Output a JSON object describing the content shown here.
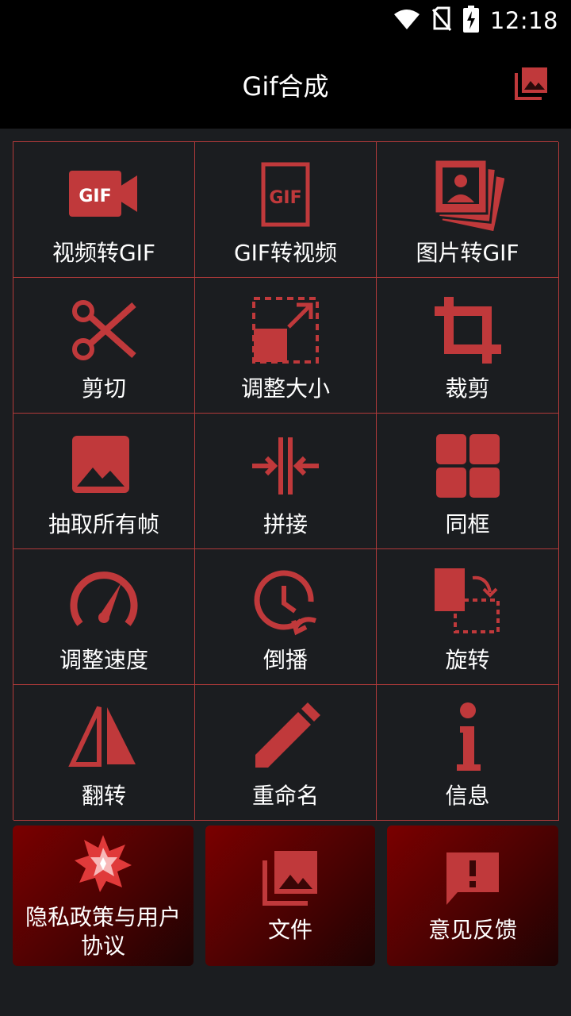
{
  "status": {
    "time": "12:18",
    "icons": [
      "wifi-icon",
      "no-sim-icon",
      "battery-charging-icon"
    ]
  },
  "appbar": {
    "title": "Gif合成",
    "right_icon": "photo-library-icon"
  },
  "colors": {
    "accent": "#c0393b",
    "background": "#1b1d20",
    "bar": "#000000",
    "card_start": "#7a0000",
    "card_end": "#1e0303"
  },
  "tools": [
    {
      "label": "视频转GIF",
      "icon": "video-gif-icon"
    },
    {
      "label": "GIF转视频",
      "icon": "gif-frame-icon"
    },
    {
      "label": "图片转GIF",
      "icon": "photo-stack-icon"
    },
    {
      "label": "剪切",
      "icon": "scissors-icon"
    },
    {
      "label": "调整大小",
      "icon": "resize-icon"
    },
    {
      "label": "裁剪",
      "icon": "crop-icon"
    },
    {
      "label": "抽取所有帧",
      "icon": "image-icon"
    },
    {
      "label": "拼接",
      "icon": "merge-icon"
    },
    {
      "label": "同框",
      "icon": "grid-icon"
    },
    {
      "label": "调整速度",
      "icon": "speedometer-icon"
    },
    {
      "label": "倒播",
      "icon": "clock-reverse-icon"
    },
    {
      "label": "旋转",
      "icon": "rotate-icon"
    },
    {
      "label": "翻转",
      "icon": "flip-icon"
    },
    {
      "label": "重命名",
      "icon": "pencil-icon"
    },
    {
      "label": "信息",
      "icon": "info-icon"
    }
  ],
  "cards": {
    "privacy": {
      "label": "隐私政策与用户协议",
      "icon": "star-burst-icon"
    },
    "files": {
      "label": "文件",
      "icon": "photo-library-icon"
    },
    "feedback": {
      "label": "意见反馈",
      "icon": "feedback-icon"
    }
  }
}
